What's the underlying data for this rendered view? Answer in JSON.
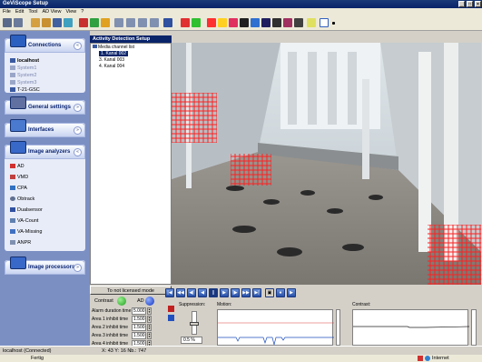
{
  "window": {
    "title": "GeViScope Setup"
  },
  "menu": [
    "File",
    "Edit",
    "Tool",
    "AD View",
    "View",
    "?"
  ],
  "sidebar": {
    "connections": {
      "title": "Connections",
      "items": [
        "localhost",
        "System1",
        "System2",
        "System3",
        "T-21-GSC"
      ]
    },
    "general": {
      "title": "General settings"
    },
    "interfaces": {
      "title": "Interfaces"
    },
    "analyzers": {
      "title": "Image analyzers",
      "items": [
        "AD",
        "VMD",
        "CPA",
        "Obtrack",
        "Dualsensor",
        "VA-Count",
        "VA-Missing",
        "ANPR"
      ]
    },
    "processors": {
      "title": "Image processors"
    }
  },
  "ad": {
    "title": "Activity Detection Setup",
    "tree_root": "Media channel list",
    "channels": [
      "1. Kanal 002",
      "3. Kanal 003",
      "4. Kanal 004"
    ],
    "not_licensed": "To not licensed mode",
    "contrast_label": "Contrast",
    "ad_label": "AD",
    "params": [
      {
        "label": "Alarm duration time",
        "value": "5.000"
      },
      {
        "label": "Area 1 inhibit time",
        "value": "1.500"
      },
      {
        "label": "Area 2 inhibit time",
        "value": "1.500"
      },
      {
        "label": "Area 3 inhibit time",
        "value": "1.500"
      },
      {
        "label": "Area 4 inhibit time",
        "value": "1.500"
      }
    ],
    "suppression_label": "Suppression:",
    "suppression_value": "0.5 %",
    "motion_label": "Motion:",
    "contrast_graph_label": "Contrast:"
  },
  "status": {
    "connection": "localhost (Connected)",
    "coords": "X: 43 Y: 16 Nb.: 747"
  },
  "taskbar": {
    "left": "Fertig",
    "right": "Internet"
  }
}
